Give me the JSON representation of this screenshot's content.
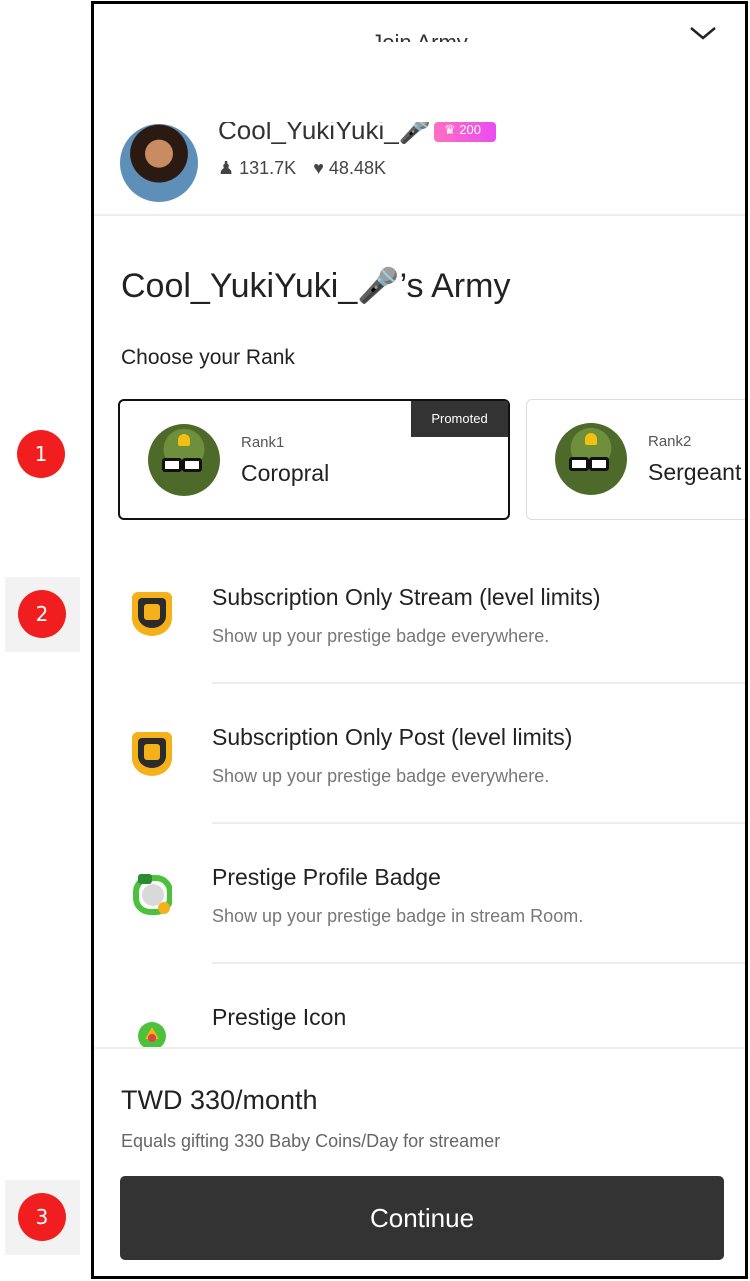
{
  "markers": [
    "1",
    "2",
    "3"
  ],
  "header": {
    "title": "Join Army"
  },
  "profile": {
    "name": "Cool_YukiYuki_🎤",
    "level": "♛ 200",
    "followers": "131.7K",
    "likes": "48.48K"
  },
  "army": {
    "title": "Cool_YukiYuki_🎤’s Army",
    "choose_label": "Choose your Rank"
  },
  "ranks": [
    {
      "label": "Rank1",
      "name": "Coropral",
      "tag": "Promoted",
      "selected": true
    },
    {
      "label": "Rank2",
      "name": "Sergeant",
      "selected": false
    }
  ],
  "features": [
    {
      "title": "Subscription Only Stream (level limits)",
      "desc": "Show up your prestige badge everywhere.",
      "icon": "stream-badge-icon"
    },
    {
      "title": "Subscription Only Post (level limits)",
      "desc": "Show up your prestige badge everywhere.",
      "icon": "post-badge-icon"
    },
    {
      "title": "Prestige Profile Badge",
      "desc": "Show up your prestige badge in stream Room.",
      "icon": "profile-badge-icon"
    },
    {
      "title": "Prestige Icon",
      "desc": "",
      "icon": "prestige-icon"
    }
  ],
  "footer": {
    "price": "TWD 330/month",
    "note": "Equals gifting 330 Baby Coins/Day for streamer",
    "continue_label": "Continue"
  },
  "colors": {
    "accent": "#333333",
    "marker": "#f01e1e",
    "badge_gold": "#f4b11a"
  }
}
